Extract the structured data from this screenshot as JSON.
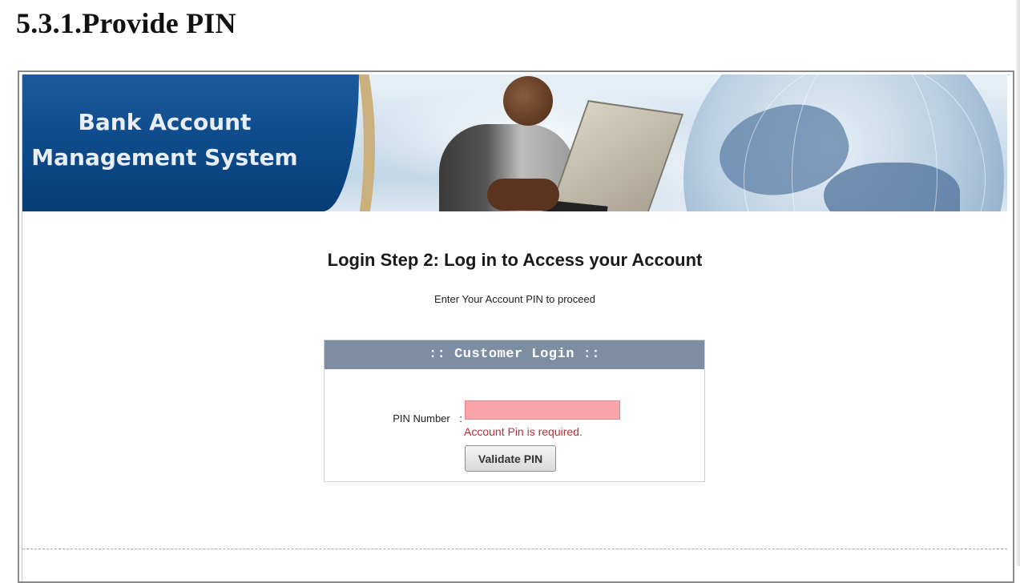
{
  "document": {
    "heading": "5.3.1.Provide PIN"
  },
  "banner": {
    "title_line1": "Bank Account",
    "title_line2": "Management System"
  },
  "login": {
    "step_title": "Login Step 2: Log in to Access your Account",
    "step_subtitle": "Enter Your Account PIN to proceed",
    "box_header": ":: Customer Login ::",
    "pin_label": "PIN Number",
    "pin_separator": ":",
    "pin_value": "",
    "pin_error": "Account Pin is required.",
    "submit_label": "Validate PIN"
  },
  "colors": {
    "banner_blue": "#0e4a8a",
    "box_header_bg": "#7d8ea3",
    "input_error_bg": "#f9a4a9",
    "error_text": "#b5303a"
  }
}
